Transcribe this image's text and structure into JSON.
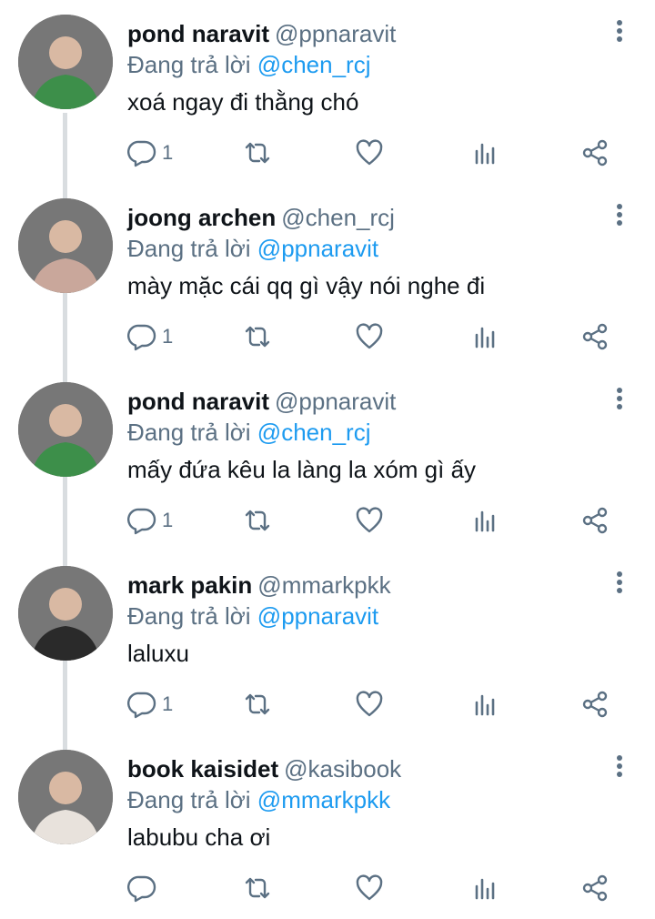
{
  "tweets": [
    {
      "name": "pond naravit",
      "handle": "@ppnaravit",
      "reply_prefix": "Đang trả lời",
      "reply_to": "@chen_rcj",
      "text": "xoá ngay đi thằng chó",
      "reply_count": "1",
      "avatar_color": "#3d8f4a"
    },
    {
      "name": "joong archen",
      "handle": "@chen_rcj",
      "reply_prefix": "Đang trả lời",
      "reply_to": "@ppnaravit",
      "text": "mày mặc cái qq gì vậy nói nghe đi",
      "reply_count": "1",
      "avatar_color": "#c9a79b"
    },
    {
      "name": "pond naravit",
      "handle": "@ppnaravit",
      "reply_prefix": "Đang trả lời",
      "reply_to": "@chen_rcj",
      "text": "mấy đứa kêu la làng la xóm gì ấy",
      "reply_count": "1",
      "avatar_color": "#3d8f4a"
    },
    {
      "name": "mark pakin",
      "handle": "@mmarkpkk",
      "reply_prefix": "Đang trả lời",
      "reply_to": "@ppnaravit",
      "text": "laluxu",
      "reply_count": "1",
      "avatar_color": "#2a2a2a"
    },
    {
      "name": "book kaisidet",
      "handle": "@kasibook",
      "reply_prefix": "Đang trả lời",
      "reply_to": "@mmarkpkk",
      "text": "labubu cha ơi",
      "reply_count": "",
      "avatar_color": "#e8e2dc"
    }
  ]
}
